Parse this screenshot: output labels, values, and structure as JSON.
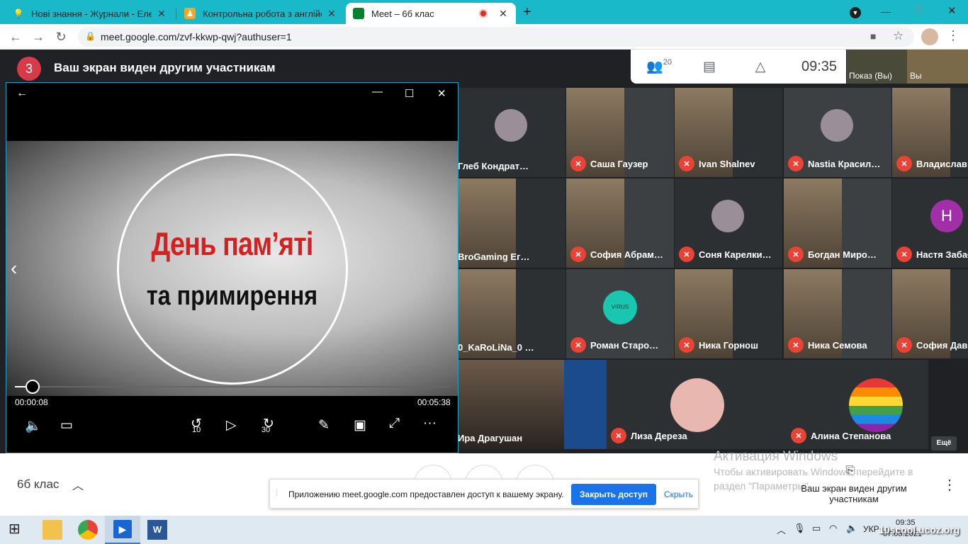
{
  "browser": {
    "tabs": [
      {
        "title": "Нові знання - Журнали - Електр",
        "active": false
      },
      {
        "title": "Контрольна робота з англійськ",
        "active": false
      },
      {
        "title": "Meet – 6б клас",
        "active": true
      }
    ],
    "new_tab": "+",
    "url": "meet.google.com/zvf-kkwp-qwj?authuser=1"
  },
  "meet": {
    "presentation_badge": "3",
    "banner": "Ваш экран виден другим участникам",
    "participants_count": "20",
    "time": "09:35",
    "self_view": {
      "left_label": "Показ (Вы)",
      "right_label": "Вы"
    },
    "more_label": "Ещё",
    "meeting_name": "6б клас",
    "tiles": [
      {
        "name": "Глеб Кондрат…",
        "avatar": "photo",
        "muted": false
      },
      {
        "name": "Саша Гаузер",
        "avatar": "photo",
        "muted": true
      },
      {
        "name": "Ivan Shalnev",
        "avatar": "photo",
        "muted": true
      },
      {
        "name": "Nastia Красил…",
        "avatar": "photo",
        "muted": true
      },
      {
        "name": "Владислав Бр…",
        "avatar": "photo",
        "muted": true
      },
      {
        "name": "BroGaming Ег…",
        "avatar": "photo",
        "muted": false
      },
      {
        "name": "София Абрам…",
        "avatar": "photo",
        "muted": true
      },
      {
        "name": "Соня Карелки…",
        "avatar": "photo",
        "muted": true
      },
      {
        "name": "Богдан Миро…",
        "avatar": "photo",
        "muted": true
      },
      {
        "name": "Настя Забабон",
        "avatar": "H",
        "muted": true
      },
      {
        "name": "0_KaRoLiNa_0 …",
        "avatar": "photo",
        "muted": false
      },
      {
        "name": "Роман Старо…",
        "avatar": "VIRUS",
        "muted": true
      },
      {
        "name": "Ника Горнош",
        "avatar": "photo",
        "muted": true
      },
      {
        "name": "Ника Семова",
        "avatar": "photo",
        "muted": true
      },
      {
        "name": "София Давыд…",
        "avatar": "photo",
        "muted": true
      },
      {
        "name": "Ира Драгушан",
        "avatar": "photo",
        "muted": false
      },
      {
        "name": "Лиза Дереза",
        "avatar": "photo",
        "muted": true
      },
      {
        "name": "Алина Степанова",
        "avatar": "photo",
        "muted": true
      }
    ]
  },
  "player": {
    "title_line1": "День пам’яті",
    "title_line2": "та примирення",
    "current_time": "00:00:08",
    "total_time": "00:05:38",
    "progress_fraction": 0.04,
    "skip_back": "10",
    "skip_forward": "30"
  },
  "share_notice": {
    "text": "Приложению meet.google.com предоставлен доступ к вашему экрану.",
    "stop_button": "Закрыть доступ",
    "hide_button": "Скрыть"
  },
  "present_button": {
    "label": "Ваш экран виден другим участникам"
  },
  "activation": {
    "title": "Активация Windows",
    "line1": "Чтобы активировать Windows, перейдите в",
    "line2": "раздел \"Параметры\"."
  },
  "taskbar": {
    "lang": "УКР",
    "time": "09:35",
    "date": "07.05.2021",
    "watermark": "10scool.ucoz.org"
  }
}
